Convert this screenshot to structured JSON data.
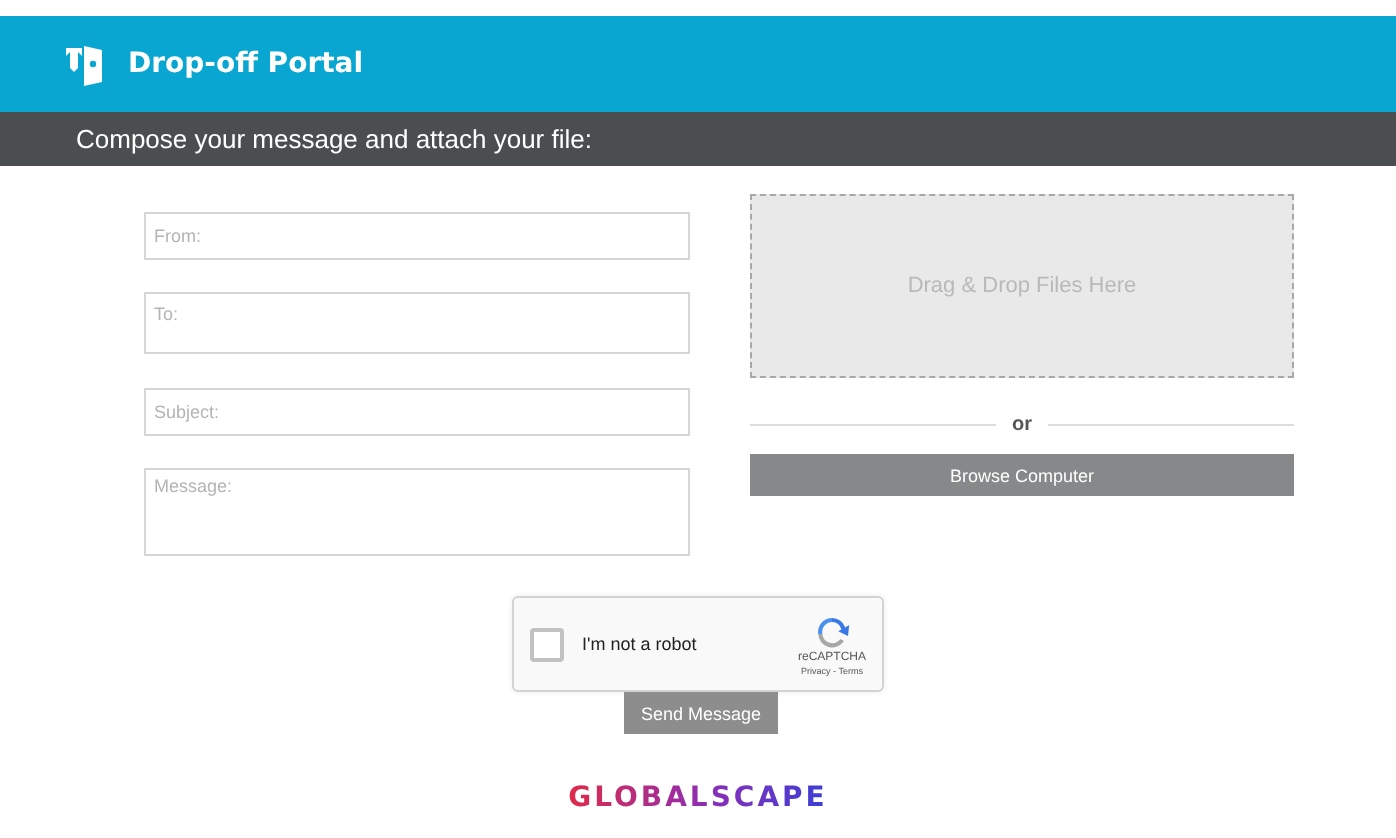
{
  "header": {
    "title": "Drop-off Portal"
  },
  "subheader": {
    "text": "Compose your message and attach your file:"
  },
  "fields": [
    {
      "placeholder": "From:",
      "kind": "line"
    },
    {
      "placeholder": "To:",
      "kind": "tall"
    },
    {
      "placeholder": "Subject:",
      "kind": "line"
    },
    {
      "placeholder": "Message:",
      "kind": "area"
    }
  ],
  "dropzone": {
    "text": "Drag & Drop Files Here"
  },
  "separator": {
    "text": "or"
  },
  "browse_button": {
    "label": "Browse Computer"
  },
  "captcha": {
    "label": "I'm not a robot",
    "checked": false,
    "brand": "reCAPTCHA",
    "links": "Privacy - Terms"
  },
  "send_button": {
    "label": "Send Message"
  },
  "footer": {
    "logo": "GLOBALSCAPE"
  }
}
